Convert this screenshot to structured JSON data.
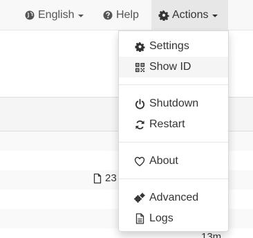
{
  "navbar": {
    "language_label": "English",
    "help_label": "Help",
    "actions_label": "Actions",
    "icons": {
      "language": "globe-icon",
      "help": "question-circle-icon",
      "actions": "gear-icon"
    }
  },
  "actions_menu": {
    "settings": "Settings",
    "show_id": "Show ID",
    "shutdown": "Shutdown",
    "restart": "Restart",
    "about": "About",
    "advanced": "Advanced",
    "logs": "Logs",
    "hovered_item": "Show ID"
  },
  "background": {
    "file_size_partial": "23",
    "time_partial": "13m"
  },
  "colors": {
    "navbar_bg": "#f8f8f8",
    "active_nav_bg": "#e7e7e7",
    "hover_bg": "#f5f5f5",
    "text": "#333333"
  }
}
